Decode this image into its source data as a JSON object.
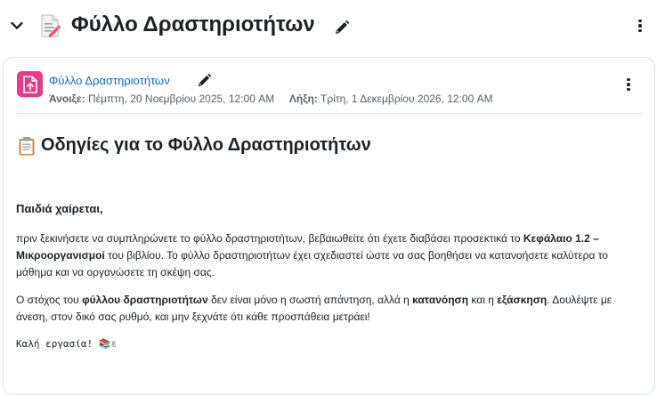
{
  "section": {
    "title": "Φύλλο Δραστηριοτήτων",
    "icons": {
      "collapse": "chevron-down-icon",
      "doc": "document-icon",
      "edit": "pencil-icon",
      "menu": "kebab-icon"
    }
  },
  "activity": {
    "name": "Φύλλο Δραστηριοτήτων",
    "opens_label": "Άνοιξε:",
    "opens_value": "Πέμπτη, 20 Νοεμβρίου 2025, 12:00 AM",
    "due_label": "Λήξη:",
    "due_value": "Τρίτη, 1 Δεκεμβρίου 2026, 12:00 AM",
    "icon_color": "#e8398d"
  },
  "content": {
    "title": "Οδηγίες για το Φύλλο Δραστηριοτήτων",
    "greeting": "Παιδιά χαίρεται,",
    "p1": {
      "t1": "πριν ξεκινήσετε να συμπληρώνετε το φύλλο δραστηριοτήτων, βεβαιωθείτε ότι έχετε διαβάσει προσεκτικά το ",
      "b1": "Κεφάλαιο 1.2 – Μικροοργανισμοί",
      "t2": " του βιβλίου. Το φύλλο δραστηριοτήτων έχει σχεδιαστεί ώστε να σας βοηθήσει να κατανοήσετε καλύτερα το μάθημα και να οργανώσετε τη σκέψη σας."
    },
    "p2": {
      "t1": "Ο στόχος του ",
      "b1": "φύλλου δραστηριοτήτων",
      "t2": " δεν είναι μόνο η σωστή απάντηση, αλλά η ",
      "b2": "κατανόηση",
      "t3": " και η ",
      "b3": "εξάσκηση",
      "t4": ". Δουλέψτε με άνεση, στον δικό σας ρυθμό, και μην ξεχνάτε ότι κάθε προσπάθεια μετράει!"
    },
    "signoff": "Καλή εργασία! 📚✌"
  },
  "colors": {
    "link": "#0f6cbf",
    "text": "#1d2125",
    "muted": "#5a5f64",
    "border": "#dee2e6"
  }
}
